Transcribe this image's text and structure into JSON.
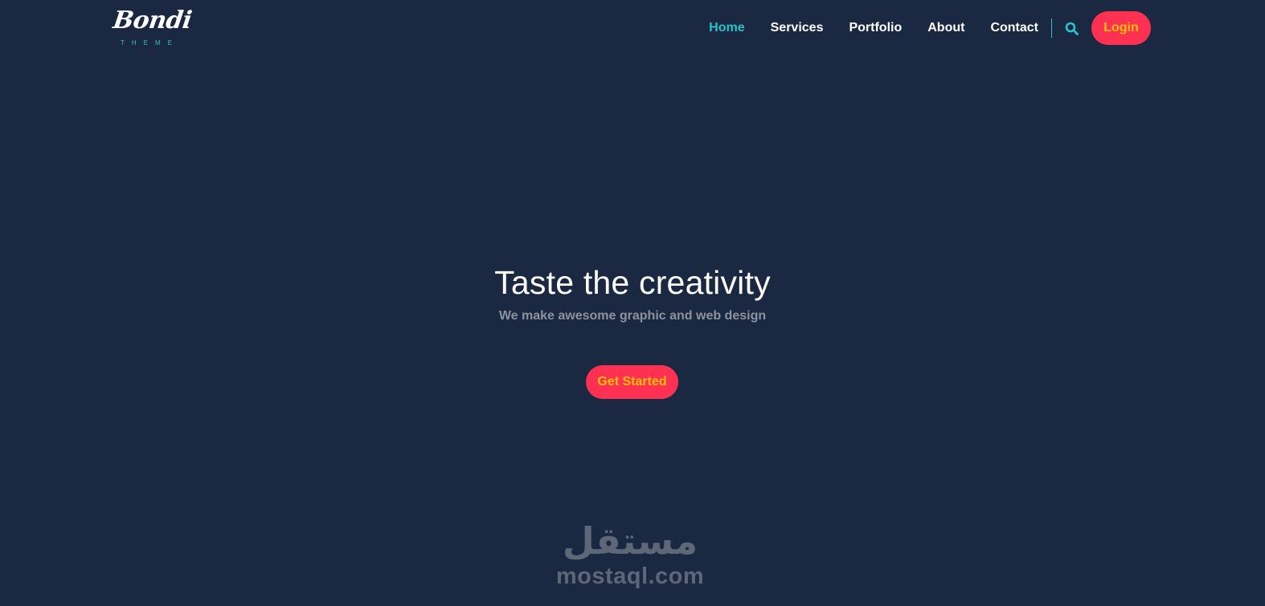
{
  "header": {
    "logo": {
      "name": "Bondi",
      "tagline": "THEME"
    },
    "nav": {
      "items": [
        {
          "label": "Home",
          "active": true
        },
        {
          "label": "Services",
          "active": false
        },
        {
          "label": "Portfolio",
          "active": false
        },
        {
          "label": "About",
          "active": false
        },
        {
          "label": "Contact",
          "active": false
        }
      ],
      "search_icon": "search-icon",
      "login_label": "Login"
    }
  },
  "hero": {
    "title": "Taste the creativity",
    "subtitle": "We make awesome graphic and web design",
    "cta_label": "Get Started"
  },
  "watermark": {
    "arabic": "مستقل",
    "latin": "mostaql.com"
  },
  "colors": {
    "background": "#1b2841",
    "accent": "#2bc3c8",
    "button": "#ff3152",
    "button_text": "#ffc107"
  }
}
